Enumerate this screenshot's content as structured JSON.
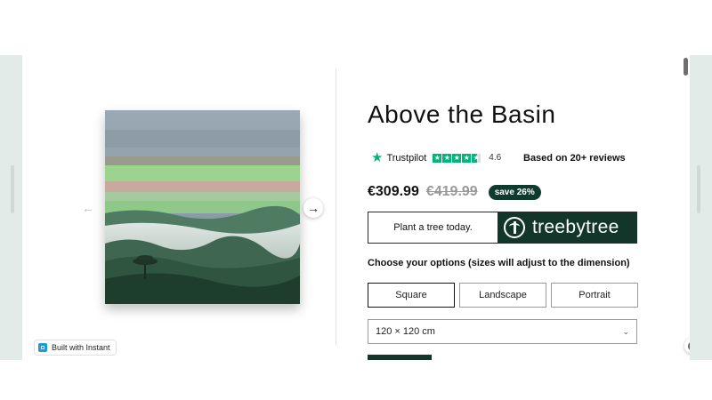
{
  "product": {
    "title": "Above the Basin",
    "price": "€309.99",
    "compare_price": "€419.99",
    "save_badge": "save 26%"
  },
  "trustpilot": {
    "brand": "Trustpilot",
    "rating": "4.6",
    "stars": 4.6,
    "reviews_text": "Based on 20+ reviews"
  },
  "tree_banner": {
    "cta": "Plant a tree today.",
    "partner": "treebytree"
  },
  "options": {
    "label": "Choose your options (sizes will adjust to the dimension)",
    "shapes": [
      "Square",
      "Landscape",
      "Portrait"
    ],
    "selected_shape": "Square",
    "size_value": "120 × 120 cm"
  },
  "badge": {
    "built_with": "Built with Instant"
  },
  "icons": {
    "prev": "arrow-left-icon",
    "next": "arrow-right-icon",
    "help": "question-icon",
    "trustpilot": "star-icon",
    "select": "chevron-down-icon"
  },
  "colors": {
    "trustpilot_green": "#00b67a",
    "brand_dark_green": "#12372a",
    "save_badge_bg": "#0e3b2e"
  }
}
